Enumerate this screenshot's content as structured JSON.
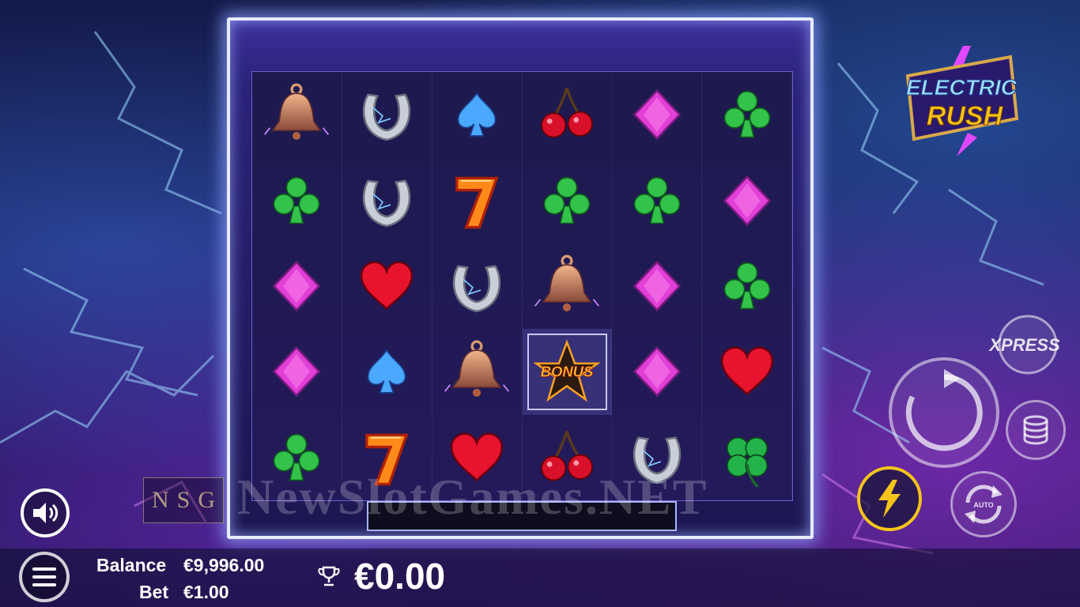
{
  "game": {
    "logo_line1": "ELECTRIC",
    "logo_line2": "RUSH"
  },
  "reels": [
    [
      "bell",
      "horseshoe",
      "spade",
      "cherry",
      "diamond",
      "club"
    ],
    [
      "club",
      "horseshoe",
      "seven",
      "club",
      "club",
      "diamond"
    ],
    [
      "diamond",
      "heart",
      "horseshoe",
      "bell",
      "diamond",
      "club"
    ],
    [
      "diamond",
      "spade",
      "bell",
      "bonus",
      "diamond",
      "heart"
    ],
    [
      "club",
      "seven",
      "heart",
      "cherry",
      "horseshoe",
      "clover"
    ]
  ],
  "bonus_label": "BONUS",
  "controls": {
    "xpress_label": "XPRESS",
    "auto_label": "AUTO",
    "spin_icon": "spin-icon",
    "coins_icon": "coins-icon",
    "turbo_icon": "lightning-icon",
    "sound_icon": "speaker-icon",
    "menu_icon": "menu-icon"
  },
  "footer": {
    "balance_label": "Balance",
    "balance_value": "€9,996.00",
    "bet_label": "Bet",
    "bet_value": "€1.00",
    "win_value": "€0.00",
    "win_icon": "trophy-icon"
  },
  "watermark": {
    "text": "NewSlotGames.NET",
    "logo_letters": [
      "N",
      "S",
      "G"
    ]
  },
  "colors": {
    "accent": "#f5c518",
    "frame": "#e8ecff",
    "background": "#1a1d5e"
  }
}
